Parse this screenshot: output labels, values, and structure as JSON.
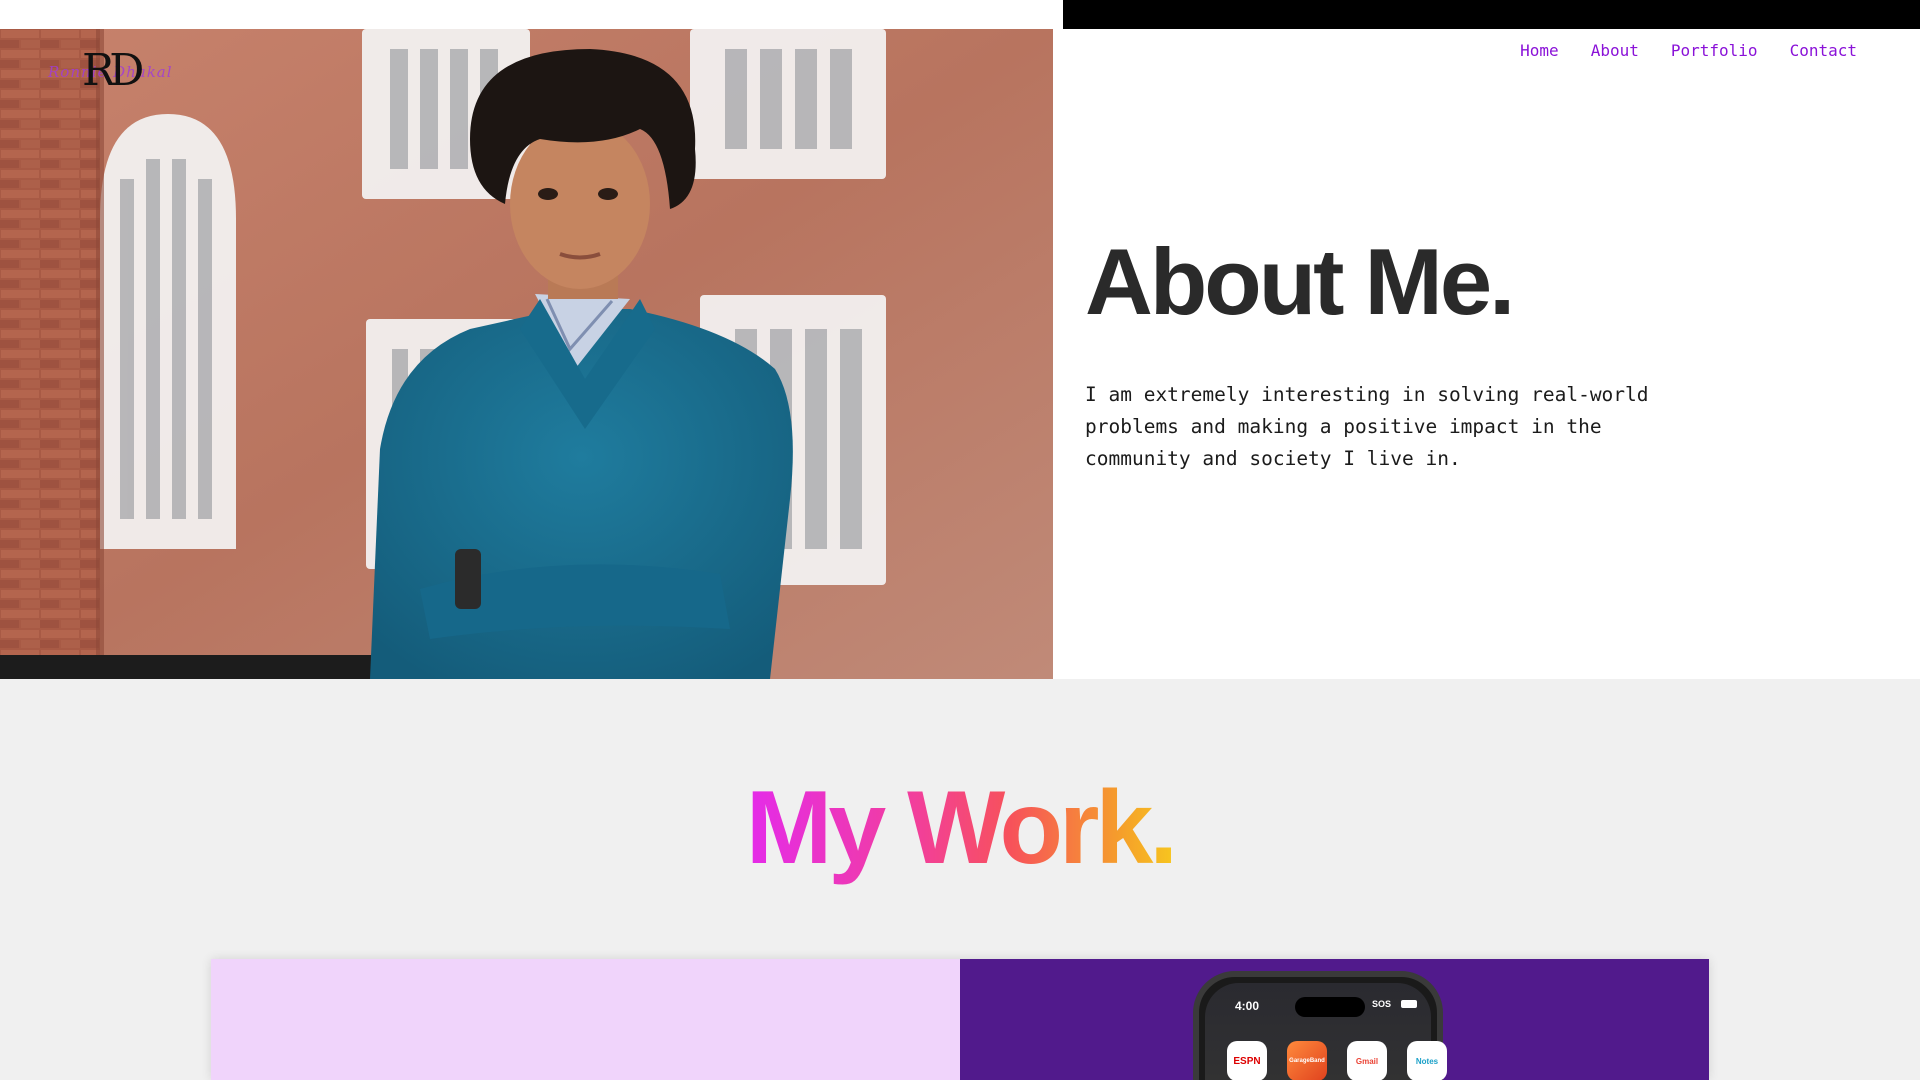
{
  "logo": {
    "mark": "RD",
    "signature": "Ronnie  Dhakal"
  },
  "nav": {
    "items": [
      {
        "label": "Home"
      },
      {
        "label": "About"
      },
      {
        "label": "Portfolio"
      },
      {
        "label": "Contact"
      }
    ]
  },
  "about": {
    "title": "About Me.",
    "body": "I am extremely interesting in solving real-world problems and making a positive impact in the community and society I live in."
  },
  "work": {
    "title": "My Work."
  },
  "phone": {
    "time": "4:00",
    "status": "SOS",
    "apps": [
      "ESPN",
      "GarageBand",
      "Gmail",
      "Notes"
    ]
  },
  "colors": {
    "nav_link": "#8a12d8",
    "about_title": "#2a2a2a",
    "card_left": "#f0d4fb",
    "card_right": "#511a8c",
    "work_gradient": [
      "#e42bea",
      "#f23f9a",
      "#f7525a",
      "#f5a02a",
      "#f7c61f"
    ]
  }
}
